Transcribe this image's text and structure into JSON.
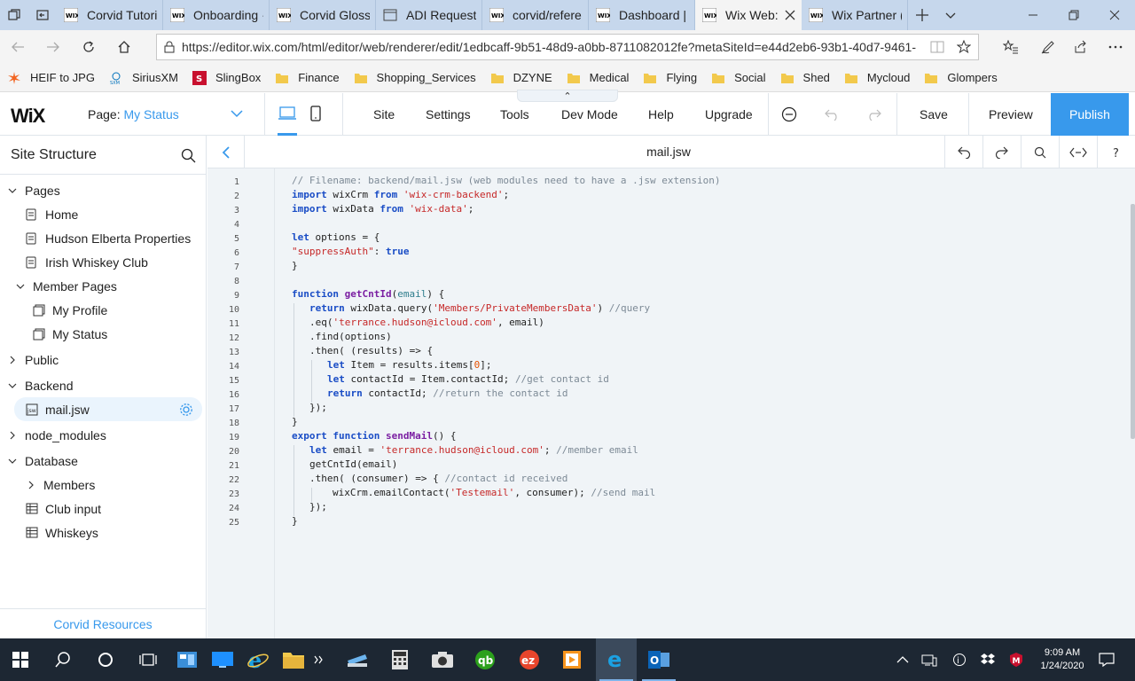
{
  "browser": {
    "tabs": [
      {
        "title": "Corvid Tutori",
        "active": false
      },
      {
        "title": "Onboarding ·",
        "active": false
      },
      {
        "title": "Corvid Gloss",
        "active": false
      },
      {
        "title": "ADI Request:",
        "active": false
      },
      {
        "title": "corvid/refere",
        "active": false
      },
      {
        "title": "Dashboard | ",
        "active": false
      },
      {
        "title": "Wix Web:",
        "active": true
      },
      {
        "title": "Wix Partner (",
        "active": false
      }
    ],
    "url": "https://editor.wix.com/html/editor/web/renderer/edit/1edbcaff-9b51-48d9-a0bb-8711082012fe?metaSiteId=e44d2eb6-93b1-40d7-9461-",
    "favorites": [
      {
        "label": "HEIF to JPG",
        "icon": "heif-icon"
      },
      {
        "label": "SiriusXM",
        "icon": "siriusxm-icon"
      },
      {
        "label": "SlingBox",
        "icon": "slingbox-icon"
      },
      {
        "label": "Finance",
        "icon": "folder-icon"
      },
      {
        "label": "Shopping_Services",
        "icon": "folder-icon"
      },
      {
        "label": "DZYNE",
        "icon": "folder-icon"
      },
      {
        "label": "Medical",
        "icon": "folder-icon"
      },
      {
        "label": "Flying",
        "icon": "folder-icon"
      },
      {
        "label": "Social",
        "icon": "folder-icon"
      },
      {
        "label": "Shed",
        "icon": "folder-icon"
      },
      {
        "label": "Mycloud",
        "icon": "folder-icon"
      },
      {
        "label": "Glompers",
        "icon": "folder-icon"
      }
    ]
  },
  "wix": {
    "logo": "WiX",
    "page_label": "Page:",
    "page_value": "My Status",
    "menu": [
      "Site",
      "Settings",
      "Tools",
      "Dev Mode",
      "Help",
      "Upgrade"
    ],
    "save_label": "Save",
    "preview_label": "Preview",
    "publish_label": "Publish",
    "accent": "#3899ec"
  },
  "sidebar": {
    "title": "Site Structure",
    "footer": "Corvid Resources",
    "tree": {
      "pages": "Pages",
      "home": "Home",
      "hudson": "Hudson Elberta Properties",
      "whiskey_club": "Irish Whiskey Club",
      "member_pages": "Member Pages",
      "my_profile": "My Profile",
      "my_status": "My Status",
      "public": "Public",
      "backend": "Backend",
      "mail_file": "mail.jsw",
      "node_modules": "node_modules",
      "database": "Database",
      "members": "Members",
      "club_input": "Club input",
      "whiskeys": "Whiskeys"
    }
  },
  "editor": {
    "filename": "mail.jsw",
    "code": {
      "l1": "// Filename: backend/mail.jsw (web modules need to have a .jsw extension)",
      "l2_kw": "import",
      "l2_id": " wixCrm ",
      "l2_from": "from",
      "l2_str": "'wix-crm-backend'",
      "l2_end": ";",
      "l3_kw": "import",
      "l3_id": " wixData ",
      "l3_from": "from",
      "l3_str": "'wix-data'",
      "l3_end": ";",
      "l5_kw": "let",
      "l5_rest": " options = {",
      "l6_str": "\"suppressAuth\"",
      "l6_mid": ": ",
      "l6_val": "true",
      "l7": "}",
      "l9_kw": "function",
      "l9_sp": " ",
      "l9_fn": "getCntId",
      "l9_p1": "(",
      "l9_prm": "email",
      "l9_p2": ") {",
      "l10_kw": "return",
      "l10_mid": " wixData.query(",
      "l10_str": "'Members/PrivateMembersData'",
      "l10_end": ") ",
      "l10_cm": "//query",
      "l11_a": ".eq(",
      "l11_str": "'terrance.hudson@icloud.com'",
      "l11_end": ", email)",
      "l12": ".find(options)",
      "l13": ".then( (results) => {",
      "l14_kw": "let",
      "l14_mid": " Item = results.items[",
      "l14_num": "0",
      "l14_end": "];",
      "l15_kw": "let",
      "l15_mid": " contactId = Item.contactId; ",
      "l15_cm": "//get contact id",
      "l16_kw": "return",
      "l16_mid": " contactId; ",
      "l16_cm": "//return the contact id",
      "l17": "});",
      "l18": "}",
      "l19_kw": "export",
      "l19_kw2": "function",
      "l19_fn": "sendMail",
      "l19_end": "() {",
      "l20_kw": "let",
      "l20_mid": " email = ",
      "l20_str": "'terrance.hudson@icloud.com'",
      "l20_end": "; ",
      "l20_cm": "//member email",
      "l21": "getCntId(email)",
      "l22_a": ".then( (consumer) => { ",
      "l22_cm": "//contact id received",
      "l23_a": "wixCrm.emailContact(",
      "l23_str": "'Testemail'",
      "l23_end": ", consumer); ",
      "l23_cm": "//send mail",
      "l24": "});",
      "l25": "}"
    },
    "line_numbers": [
      "1",
      "2",
      "3",
      "4",
      "5",
      "6",
      "7",
      "8",
      "9",
      "10",
      "11",
      "12",
      "13",
      "14",
      "15",
      "16",
      "17",
      "18",
      "19",
      "20",
      "21",
      "22",
      "23",
      "24",
      "25"
    ]
  },
  "taskbar": {
    "time": "9:09 AM",
    "date": "1/24/2020"
  }
}
